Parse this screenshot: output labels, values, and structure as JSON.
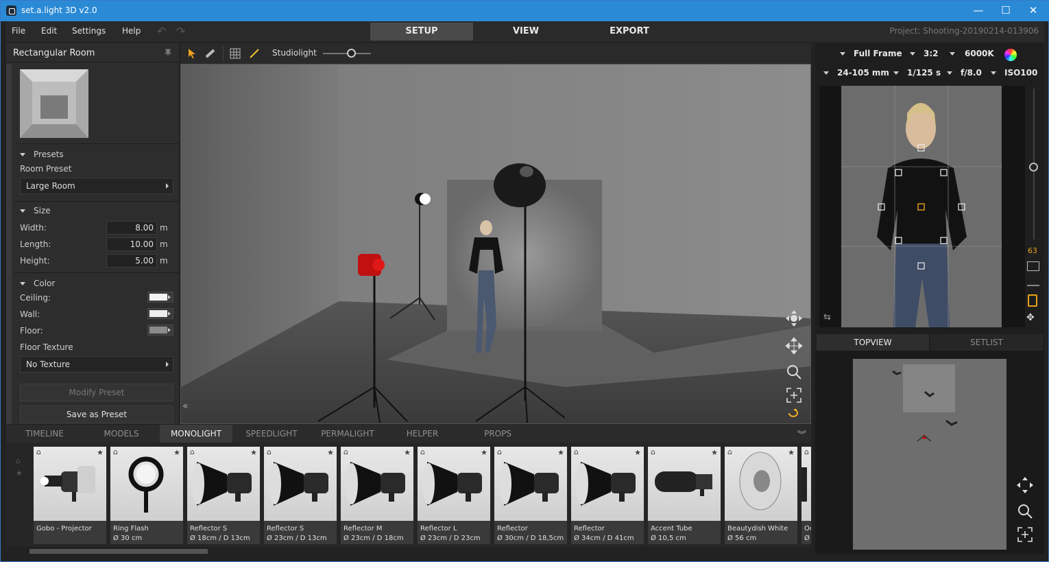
{
  "window": {
    "title": "set.a.light 3D v2.0",
    "minimize": "—",
    "maximize": "☐",
    "close": "✕"
  },
  "menu": {
    "items": [
      "File",
      "Edit",
      "Settings",
      "Help"
    ],
    "undo": "↶",
    "redo": "↷",
    "tabs": [
      "SETUP",
      "VIEW",
      "EXPORT"
    ],
    "project": "Project: Shooting-20190214-013906"
  },
  "left_panel": {
    "title": "Rectangular Room",
    "presets_heading": "Presets",
    "room_preset_label": "Room Preset",
    "room_preset_value": "Large Room",
    "size_heading": "Size",
    "width_label": "Width:",
    "width_value": "8.00",
    "length_label": "Length:",
    "length_value": "10.00",
    "height_label": "Height:",
    "height_value": "5.00",
    "unit": "m",
    "color_heading": "Color",
    "ceiling_label": "Ceiling:",
    "ceiling_color": "#f2f2f2",
    "wall_label": "Wall:",
    "wall_color": "#eeeeee",
    "floor_label": "Floor:",
    "floor_color": "#8a8a8a",
    "floor_texture_label": "Floor Texture",
    "floor_texture_value": "No Texture",
    "modify_preset": "Modify Preset",
    "save_preset": "Save as Preset"
  },
  "viewport_toolbar": {
    "mode_label": "Studiolight"
  },
  "camera": {
    "format": "Full Frame",
    "ratio": "3:2",
    "white_balance": "6000K",
    "lens": "24-105 mm",
    "shutter": "1/125 s",
    "aperture": "f/8.0",
    "iso": "ISO100",
    "focal_readout": "63"
  },
  "right_tabs": [
    "TOPVIEW",
    "SETLIST"
  ],
  "bottom_tabs": [
    "TIMELINE",
    "MODELS",
    "MONOLIGHT",
    "SPEEDLIGHT",
    "PERMALIGHT",
    "HELPER",
    "PROPS"
  ],
  "gallery": [
    {
      "name": "Gobo - Projector",
      "dims": ""
    },
    {
      "name": "Ring Flash",
      "dims": "Ø 30 cm"
    },
    {
      "name": "Reflector S",
      "dims": "Ø 18cm / D 13cm"
    },
    {
      "name": "Reflector S",
      "dims": "Ø 23cm / D 13cm"
    },
    {
      "name": "Reflector M",
      "dims": "Ø 23cm / D 18cm"
    },
    {
      "name": "Reflector L",
      "dims": "Ø 23cm / D 23cm"
    },
    {
      "name": "Reflector",
      "dims": "Ø 30cm / D 18,5cm"
    },
    {
      "name": "Reflector",
      "dims": "Ø 34cm / D 41cm"
    },
    {
      "name": "Accent Tube",
      "dims": "Ø 10,5 cm"
    },
    {
      "name": "Beautydish White",
      "dims": "Ø 56 cm"
    },
    {
      "name": "Oc",
      "dims": "Ø"
    }
  ],
  "colors": {
    "accent_blue": "#2b8ad6",
    "active_tab": "#4a4a4a",
    "focal_orange": "#e8a317"
  }
}
